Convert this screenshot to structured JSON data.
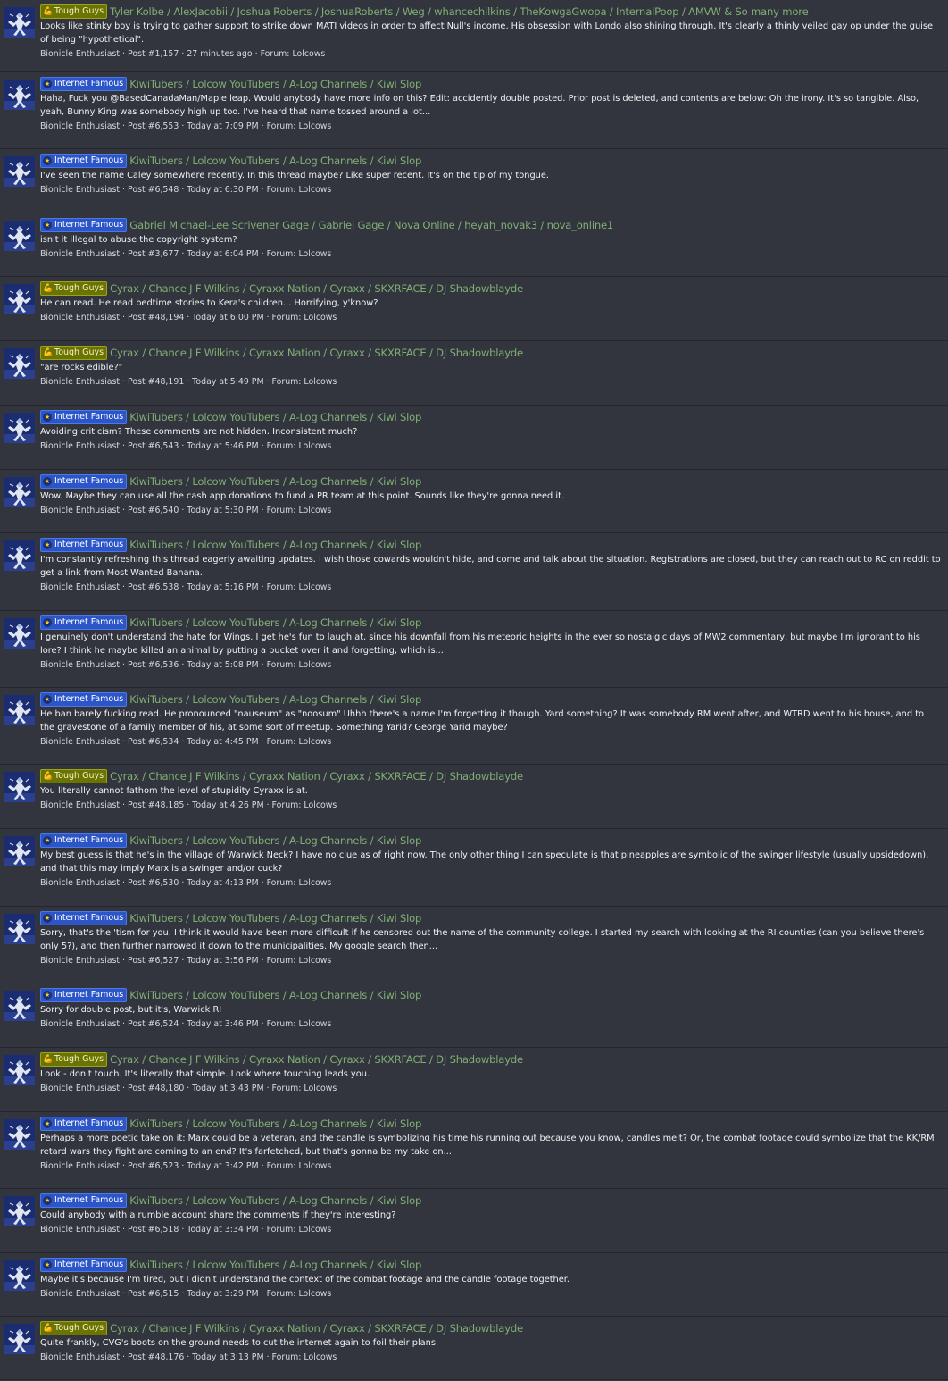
{
  "labels": {
    "tough": "Tough Guys",
    "famous": "Internet Famous"
  },
  "icons": {
    "tough": "flexed-bicep-icon",
    "famous": "star-badge-icon",
    "avatar": "bionicle-figure-icon"
  },
  "meta": {
    "post_prefix": "Post #",
    "forum_prefix": "Forum:",
    "separator": "·"
  },
  "results": [
    {
      "label": "tough",
      "title": "Tyler Kolbe / AlexJacobii / Joshua Roberts / JoshuaRoberts / Weg / whancechilkins / TheKowgaGwopa / InternalPoop / AMVW & So many more",
      "snippet": "Looks like stinky boy is trying to gather support to strike down MATI videos in order to affect Null's income. His obsession with Londo also shining through. It's clearly a thinly veiled gay op under the guise of being \"hypothetical\".",
      "author": "Bionicle Enthusiast",
      "post": "1,157",
      "time": "27 minutes ago",
      "forum": "Lolcows"
    },
    {
      "label": "famous",
      "title": "KiwiTubers / Lolcow YouTubers / A-Log Channels / Kiwi Slop",
      "snippet": "Haha, Fuck you @BasedCanadaMan/Maple leap. Would anybody have more info on this? Edit: accidently double posted. Prior post is deleted, and contents are below: Oh the irony. It's so tangible. Also, yeah, Bunny King was somebody high up too. I've heard that name tossed around a lot...",
      "author": "Bionicle Enthusiast",
      "post": "6,553",
      "time": "Today at 7:09 PM",
      "forum": "Lolcows"
    },
    {
      "label": "famous",
      "title": "KiwiTubers / Lolcow YouTubers / A-Log Channels / Kiwi Slop",
      "snippet": "I've seen the name Caley somewhere recently. In this thread maybe? Like super recent. It's on the tip of my tongue.",
      "author": "Bionicle Enthusiast",
      "post": "6,548",
      "time": "Today at 6:30 PM",
      "forum": "Lolcows"
    },
    {
      "label": "famous",
      "title": "Gabriel Michael-Lee Scrivener Gage / Gabriel Gage / Nova Online / heyah_novak3 / nova_online1",
      "snippet": "isn't it illegal to abuse the copyright system?",
      "author": "Bionicle Enthusiast",
      "post": "3,677",
      "time": "Today at 6:04 PM",
      "forum": "Lolcows"
    },
    {
      "label": "tough",
      "title": "Cyrax / Chance J F Wilkins / Cyraxx Nation / Cyraxx / SKXRFACE / DJ Shadowblayde",
      "snippet": "He can read. He read bedtime stories to Kera's children... Horrifying, y'know?",
      "author": "Bionicle Enthusiast",
      "post": "48,194",
      "time": "Today at 6:00 PM",
      "forum": "Lolcows"
    },
    {
      "label": "tough",
      "title": "Cyrax / Chance J F Wilkins / Cyraxx Nation / Cyraxx / SKXRFACE / DJ Shadowblayde",
      "snippet": "\"are rocks edible?\"",
      "author": "Bionicle Enthusiast",
      "post": "48,191",
      "time": "Today at 5:49 PM",
      "forum": "Lolcows"
    },
    {
      "label": "famous",
      "title": "KiwiTubers / Lolcow YouTubers / A-Log Channels / Kiwi Slop",
      "snippet": "Avoiding criticism? These comments are not hidden. Inconsistent much?",
      "author": "Bionicle Enthusiast",
      "post": "6,543",
      "time": "Today at 5:46 PM",
      "forum": "Lolcows"
    },
    {
      "label": "famous",
      "title": "KiwiTubers / Lolcow YouTubers / A-Log Channels / Kiwi Slop",
      "snippet": "Wow. Maybe they can use all the cash app donations to fund a PR team at this point. Sounds like they're gonna need it.",
      "author": "Bionicle Enthusiast",
      "post": "6,540",
      "time": "Today at 5:30 PM",
      "forum": "Lolcows"
    },
    {
      "label": "famous",
      "title": "KiwiTubers / Lolcow YouTubers / A-Log Channels / Kiwi Slop",
      "snippet": "I'm constantly refreshing this thread eagerly awaiting updates. I wish those cowards wouldn't hide, and come and talk about the situation. Registrations are closed, but they can reach out to RC on reddit to get a link from Most Wanted Banana.",
      "author": "Bionicle Enthusiast",
      "post": "6,538",
      "time": "Today at 5:16 PM",
      "forum": "Lolcows"
    },
    {
      "label": "famous",
      "title": "KiwiTubers / Lolcow YouTubers / A-Log Channels / Kiwi Slop",
      "snippet": "I genuinely don't understand the hate for Wings. I get he's fun to laugh at, since his downfall from his meteoric heights in the ever so nostalgic days of MW2 commentary, but maybe I'm ignorant to his lore? I think he maybe killed an animal by putting a bucket over it and forgetting, which is...",
      "author": "Bionicle Enthusiast",
      "post": "6,536",
      "time": "Today at 5:08 PM",
      "forum": "Lolcows"
    },
    {
      "label": "famous",
      "title": "KiwiTubers / Lolcow YouTubers / A-Log Channels / Kiwi Slop",
      "snippet": "He ban barely fucking read. He pronounced \"nauseum\" as \"noosum\" Uhhh there's a name I'm forgetting it though. Yard something? It was somebody RM went after, and WTRD went to his house, and to the gravestone of a family member of his, at some sort of meetup. Something Yarid? George Yarid maybe?",
      "author": "Bionicle Enthusiast",
      "post": "6,534",
      "time": "Today at 4:45 PM",
      "forum": "Lolcows"
    },
    {
      "label": "tough",
      "title": "Cyrax / Chance J F Wilkins / Cyraxx Nation / Cyraxx / SKXRFACE / DJ Shadowblayde",
      "snippet": "You literally cannot fathom the level of stupidity Cyraxx is at.",
      "author": "Bionicle Enthusiast",
      "post": "48,185",
      "time": "Today at 4:26 PM",
      "forum": "Lolcows"
    },
    {
      "label": "famous",
      "title": "KiwiTubers / Lolcow YouTubers / A-Log Channels / Kiwi Slop",
      "snippet": "My best guess is that he's in the village of Warwick Neck? I have no clue as of right now. The only other thing I can speculate is that pineapples are symbolic of the swinger lifestyle (usually upsidedown), and that this may imply Marx is a swinger and/or cuck?",
      "author": "Bionicle Enthusiast",
      "post": "6,530",
      "time": "Today at 4:13 PM",
      "forum": "Lolcows"
    },
    {
      "label": "famous",
      "title": "KiwiTubers / Lolcow YouTubers / A-Log Channels / Kiwi Slop",
      "snippet": "Sorry, that's the 'tism for you. I think it would have been more difficult if he censored out the name of the community college. I started my search with looking at the RI counties (can you believe there's only 5?), and then further narrowed it down to the municipalities. My google search then...",
      "author": "Bionicle Enthusiast",
      "post": "6,527",
      "time": "Today at 3:56 PM",
      "forum": "Lolcows"
    },
    {
      "label": "famous",
      "title": "KiwiTubers / Lolcow YouTubers / A-Log Channels / Kiwi Slop",
      "snippet": "Sorry for double post, but it's, Warwick RI",
      "author": "Bionicle Enthusiast",
      "post": "6,524",
      "time": "Today at 3:46 PM",
      "forum": "Lolcows"
    },
    {
      "label": "tough",
      "title": "Cyrax / Chance J F Wilkins / Cyraxx Nation / Cyraxx / SKXRFACE / DJ Shadowblayde",
      "snippet": "Look - don't touch. It's literally that simple. Look where touching leads you.",
      "author": "Bionicle Enthusiast",
      "post": "48,180",
      "time": "Today at 3:43 PM",
      "forum": "Lolcows"
    },
    {
      "label": "famous",
      "title": "KiwiTubers / Lolcow YouTubers / A-Log Channels / Kiwi Slop",
      "snippet": "Perhaps a more poetic take on it: Marx could be a veteran, and the candle is symbolizing his time his running out because you know, candles melt? Or, the combat footage could symbolize that the KK/RM retard wars they fight are coming to an end? It's farfetched, but that's gonna be my take on...",
      "author": "Bionicle Enthusiast",
      "post": "6,523",
      "time": "Today at 3:42 PM",
      "forum": "Lolcows"
    },
    {
      "label": "famous",
      "title": "KiwiTubers / Lolcow YouTubers / A-Log Channels / Kiwi Slop",
      "snippet": "Could anybody with a rumble account share the comments if they're interesting?",
      "author": "Bionicle Enthusiast",
      "post": "6,518",
      "time": "Today at 3:34 PM",
      "forum": "Lolcows"
    },
    {
      "label": "famous",
      "title": "KiwiTubers / Lolcow YouTubers / A-Log Channels / Kiwi Slop",
      "snippet": "Maybe it's because I'm tired, but I didn't understand the context of the combat footage and the candle footage together.",
      "author": "Bionicle Enthusiast",
      "post": "6,515",
      "time": "Today at 3:29 PM",
      "forum": "Lolcows"
    },
    {
      "label": "tough",
      "title": "Cyrax / Chance J F Wilkins / Cyraxx Nation / Cyraxx / SKXRFACE / DJ Shadowblayde",
      "snippet": "Quite frankly, CVG's boots on the ground needs to cut the internet again to foil their plans.",
      "author": "Bionicle Enthusiast",
      "post": "48,176",
      "time": "Today at 3:13 PM",
      "forum": "Lolcows"
    }
  ]
}
